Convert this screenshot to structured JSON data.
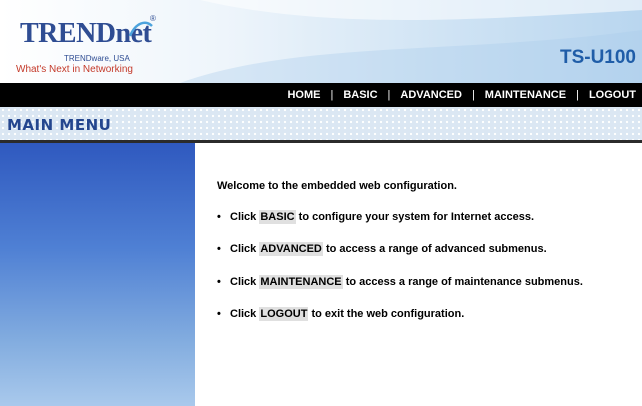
{
  "header": {
    "logo": "TRENDnet",
    "logo_sub": "TRENDware, USA",
    "tagline": "What's Next in Networking",
    "model": "TS-U100"
  },
  "nav": {
    "items": [
      "HOME",
      "BASIC",
      "ADVANCED",
      "MAINTENANCE",
      "LOGOUT"
    ],
    "separator": "|"
  },
  "titlebar": {
    "title": "MAIN MENU"
  },
  "content": {
    "welcome": "Welcome to the embedded web configuration.",
    "bullet": "•",
    "items": [
      {
        "prefix": "Click ",
        "link": "BASIC",
        "suffix": " to configure your system for Internet access."
      },
      {
        "prefix": "Click ",
        "link": "ADVANCED",
        "suffix": " to access a range of advanced submenus."
      },
      {
        "prefix": "Click ",
        "link": "MAINTENANCE",
        "suffix": " to access a range of maintenance submenus."
      },
      {
        "prefix": "Click ",
        "link": "LOGOUT",
        "suffix": " to exit the web configuration."
      }
    ]
  },
  "colors": {
    "nav_bg": "#000000",
    "brand_blue": "#2f4d93",
    "tagline_red": "#c43a2a",
    "model_blue": "#1f5da8",
    "sidebar_top": "#2f59bf",
    "sidebar_bottom": "#a9c9ec"
  }
}
